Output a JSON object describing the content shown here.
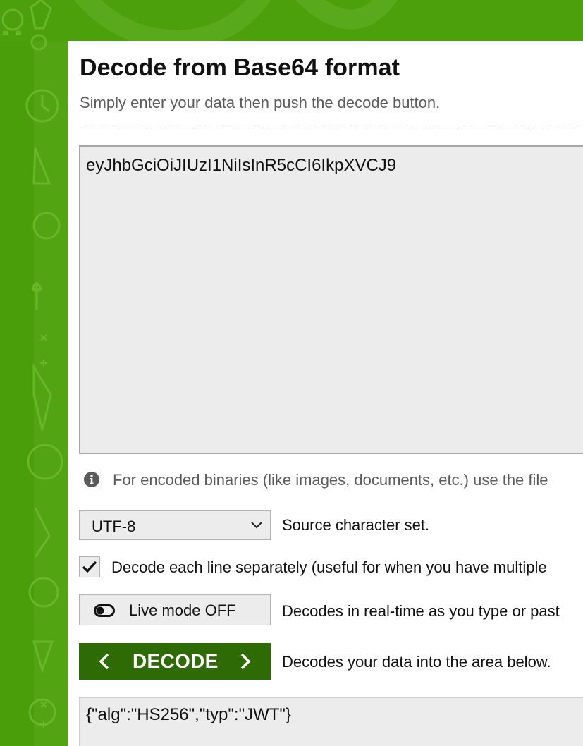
{
  "page": {
    "title": "Decode from Base64 format",
    "subtitle": "Simply enter your data then push the decode button."
  },
  "input": {
    "value": "eyJhbGciOiJIUzI1NiIsInR5cCI6IkpXVCJ9"
  },
  "info": {
    "icon": "info-circle-icon",
    "text": "For encoded binaries (like images, documents, etc.) use the file"
  },
  "charset": {
    "selected": "UTF-8",
    "label": "Source character set."
  },
  "line_option": {
    "checked": true,
    "label": "Decode each line separately (useful for when you have multiple"
  },
  "live_mode": {
    "button_label": "Live mode OFF",
    "description": "Decodes in real-time as you type or past"
  },
  "decode": {
    "button_label": "DECODE",
    "description": "Decodes your data into the area below."
  },
  "output": {
    "value": "{\"alg\":\"HS256\",\"typ\":\"JWT\"}"
  },
  "colors": {
    "background_green": "#4a9e0a",
    "decode_button": "#2e6b05",
    "field_background": "#ececec"
  }
}
